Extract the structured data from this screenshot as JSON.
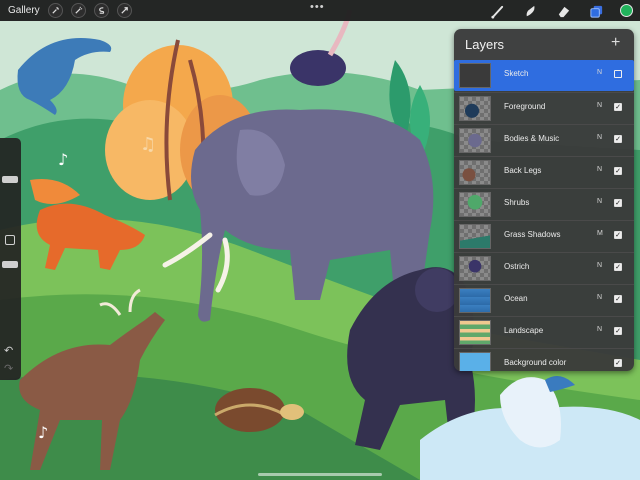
{
  "toolbar": {
    "gallery_label": "Gallery",
    "left_tools": [
      "wrench-icon",
      "magic-wand-icon",
      "selection-icon",
      "transform-arrow-icon"
    ],
    "more_label": "•••",
    "right_tools": [
      "brush-icon",
      "smudge-icon",
      "eraser-icon",
      "layers-icon"
    ],
    "active_color": "#21b45c"
  },
  "sidebar": {
    "size_slider": 0.25,
    "opacity_slider": 0.8,
    "undo_label": "↶",
    "redo_label": "↷"
  },
  "layers_panel": {
    "title": "Layers",
    "add_label": "+",
    "layers": [
      {
        "name": "Sketch",
        "blend": "N",
        "visible": false,
        "selected": true
      },
      {
        "name": "Foreground",
        "blend": "N",
        "visible": true,
        "selected": false
      },
      {
        "name": "Bodies & Music",
        "blend": "N",
        "visible": true,
        "selected": false
      },
      {
        "name": "Back Legs",
        "blend": "N",
        "visible": true,
        "selected": false
      },
      {
        "name": "Shrubs",
        "blend": "N",
        "visible": true,
        "selected": false
      },
      {
        "name": "Grass Shadows",
        "blend": "M",
        "visible": true,
        "selected": false
      },
      {
        "name": "Ostrich",
        "blend": "N",
        "visible": true,
        "selected": false
      },
      {
        "name": "Ocean",
        "blend": "N",
        "visible": true,
        "selected": false
      },
      {
        "name": "Landscape",
        "blend": "N",
        "visible": true,
        "selected": false
      },
      {
        "name": "Background color",
        "blend": "",
        "visible": true,
        "selected": false
      }
    ]
  },
  "colors": {
    "accent": "#2f6de0",
    "background_layer": "#5ab0e8"
  }
}
